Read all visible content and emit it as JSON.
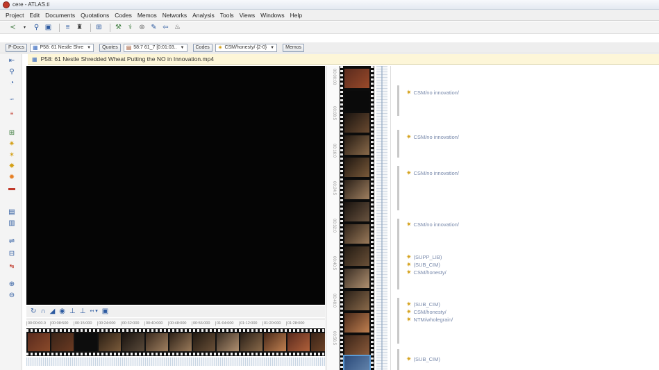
{
  "window": {
    "title": "cere - ATLAS.ti"
  },
  "menu": [
    "Project",
    "Edit",
    "Documents",
    "Quotations",
    "Codes",
    "Memos",
    "Networks",
    "Analysis",
    "Tools",
    "Views",
    "Windows",
    "Help"
  ],
  "navigator": {
    "pdocs_label": "P-Docs",
    "pdoc_value": "P58: 61 Nestle Shre",
    "quotes_label": "Quotes",
    "quote_value": "58:7 61_7 [0:01:03..",
    "codes_label": "Codes",
    "code_value": "CSM/honesty/ {2-0}",
    "memos_label": "Memos"
  },
  "document": {
    "title": "P58: 61 Nestle Shredded Wheat Putting the NO in Innovation.mp4"
  },
  "timeline": {
    "ticks": [
      "00:00:00.0",
      "00:08:500",
      "00:15:000",
      "00:24:000",
      "00:32:000",
      "00:40:000",
      "00:48:000",
      "00:56:000",
      "01:04:000",
      "01:12:000",
      "01:20:000",
      "01:28:000"
    ]
  },
  "vertical_timecodes": [
    "00:00:00",
    "00:08:5",
    "00:16:0",
    "00:24:5",
    "00:32:0",
    "00:40:5",
    "00:48:0",
    "00:56:5"
  ],
  "margin_codes": [
    {
      "label": "CSM/no innovation/"
    },
    {
      "label": "CSM/no innovation/"
    },
    {
      "label": "CSM/no innovation/"
    },
    {
      "label": "CSM/no innovation/"
    },
    {
      "label": "(SUPP_LIB)"
    },
    {
      "label": "(SUB_CIM)"
    },
    {
      "label": "CSM/honesty/"
    },
    {
      "label": "(SUB_CIM)"
    },
    {
      "label": "CSM/honesty/"
    },
    {
      "label": "NTM/wholegrain/"
    },
    {
      "label": "(SUB_CIM)"
    }
  ],
  "colors": {
    "doc_header_bg": "#fdf6d8",
    "code_star": "#d4a017",
    "code_text": "#7788aa",
    "selection": "#5b9bd5"
  }
}
